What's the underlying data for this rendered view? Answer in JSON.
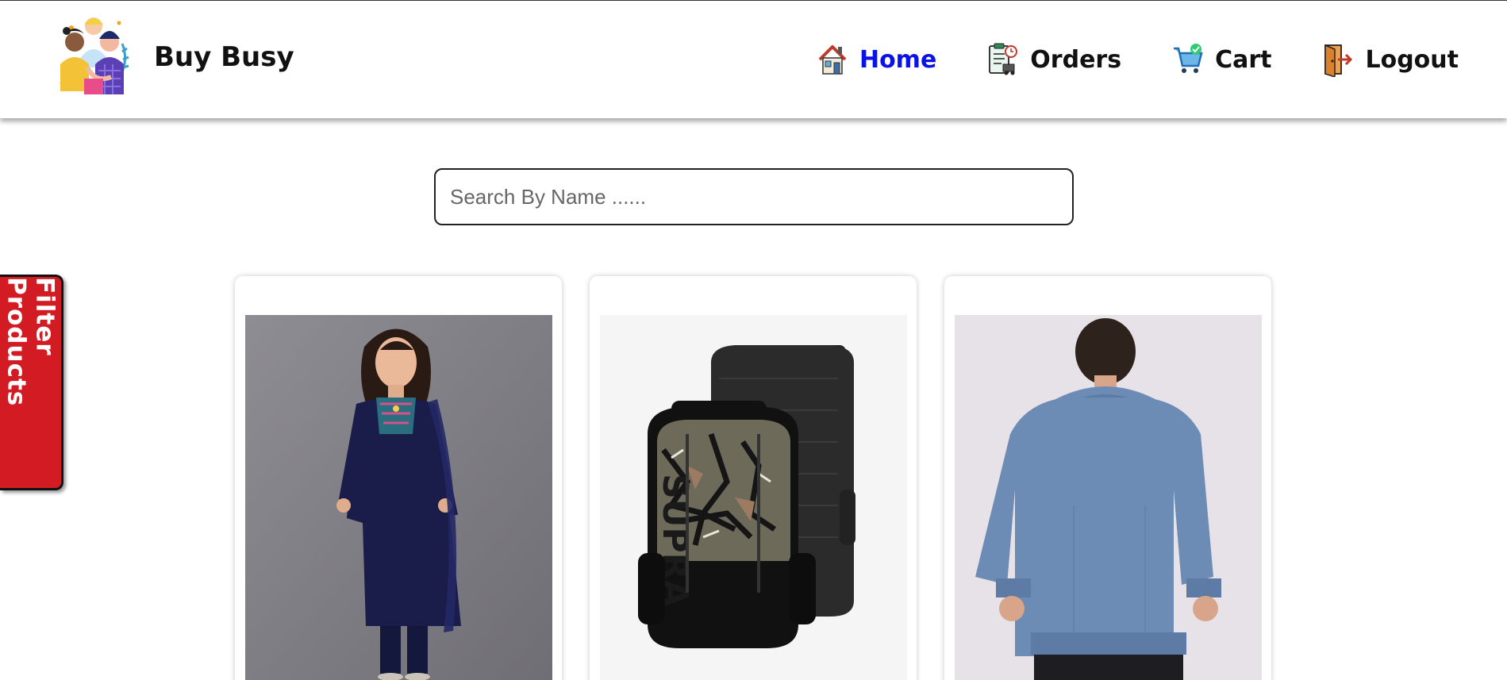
{
  "brand": {
    "name": "Buy Busy",
    "logo_icon": "friends-logo-icon"
  },
  "nav": [
    {
      "label": "Home",
      "icon": "house-icon",
      "active": true
    },
    {
      "label": "Orders",
      "icon": "orders-clipboard-icon",
      "active": false
    },
    {
      "label": "Cart",
      "icon": "shopping-cart-icon",
      "active": false
    },
    {
      "label": "Logout",
      "icon": "logout-door-icon",
      "active": false
    }
  ],
  "search": {
    "placeholder": "Search By Name ......",
    "value": ""
  },
  "filter": {
    "label": "Filter Products"
  },
  "products": [
    {
      "image": "navy-kurta-dupatta-set"
    },
    {
      "image": "camo-backpack"
    },
    {
      "image": "blue-hoodie-back"
    }
  ],
  "colors": {
    "active_nav": "#0a12e6",
    "filter_bg": "#d21b23"
  }
}
